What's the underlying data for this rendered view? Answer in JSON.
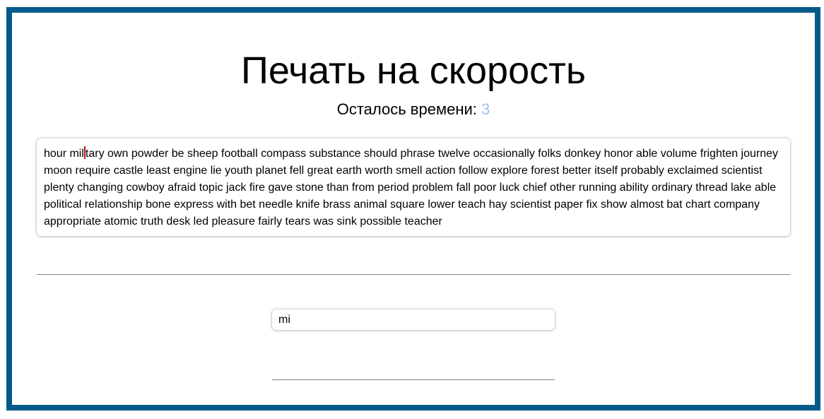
{
  "page": {
    "title": "Печать на скорость",
    "timer_label": "Осталось времени:",
    "timer_value": "3"
  },
  "text": {
    "typed_before_cursor": "hour mil",
    "remaining": "tary own powder be sheep football compass substance should phrase twelve occasionally folks donkey honor able volume frighten journey moon require castle least engine lie youth planet fell great earth worth smell action follow explore forest better itself probably exclaimed scientist plenty changing cowboy afraid topic jack fire gave stone than from period problem fall poor luck chief other running ability ordinary thread lake able political relationship bone express with bet needle knife brass animal square lower teach hay scientist paper fix show almost bat chart company appropriate atomic truth desk led pleasure fairly tears was sink possible teacher"
  },
  "input": {
    "value": "mi"
  },
  "colors": {
    "frame_border": "#045a8a",
    "timer_value": "#9ec1f0",
    "cursor": "#c0141b"
  }
}
